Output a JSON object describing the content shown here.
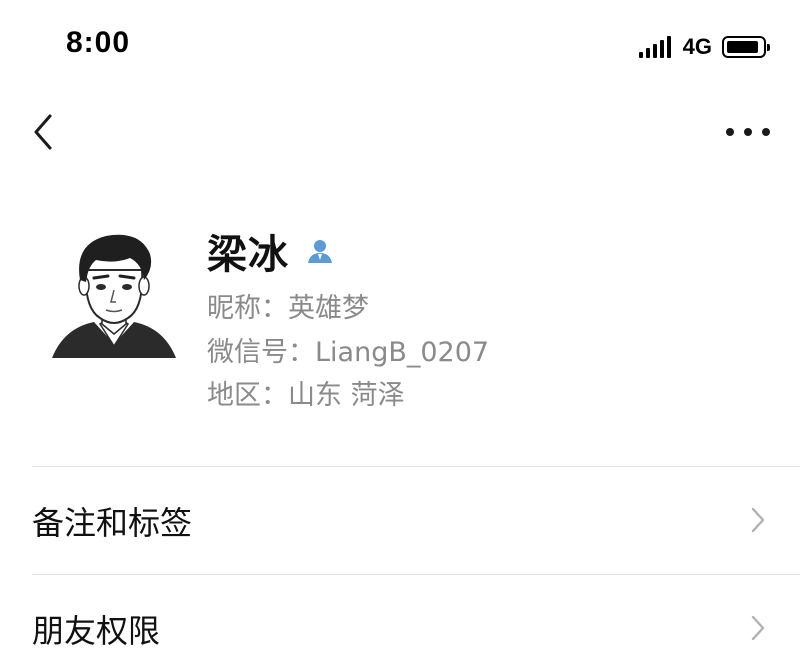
{
  "status_bar": {
    "time": "8:00",
    "network": "4G",
    "battery_level": 0.85,
    "signal_icon": "signal-bars-icon",
    "battery_icon": "battery-icon"
  },
  "nav": {
    "back_icon": "chevron-left-icon",
    "more_icon": "more-dots-icon"
  },
  "profile": {
    "name": "梁冰",
    "gender_icon": "person-badge-icon",
    "nickname": "昵称：英雄梦",
    "wechat_id": "微信号：LiangB_0207",
    "region": "地区：山东 菏泽"
  },
  "menu": {
    "items": [
      {
        "label": "备注和标签"
      },
      {
        "label": "朋友权限"
      }
    ]
  },
  "colors": {
    "text_primary": "#111111",
    "text_secondary": "#8a8a8a",
    "divider": "#e4e4e4",
    "accent_icon": "#5b9bd5"
  }
}
